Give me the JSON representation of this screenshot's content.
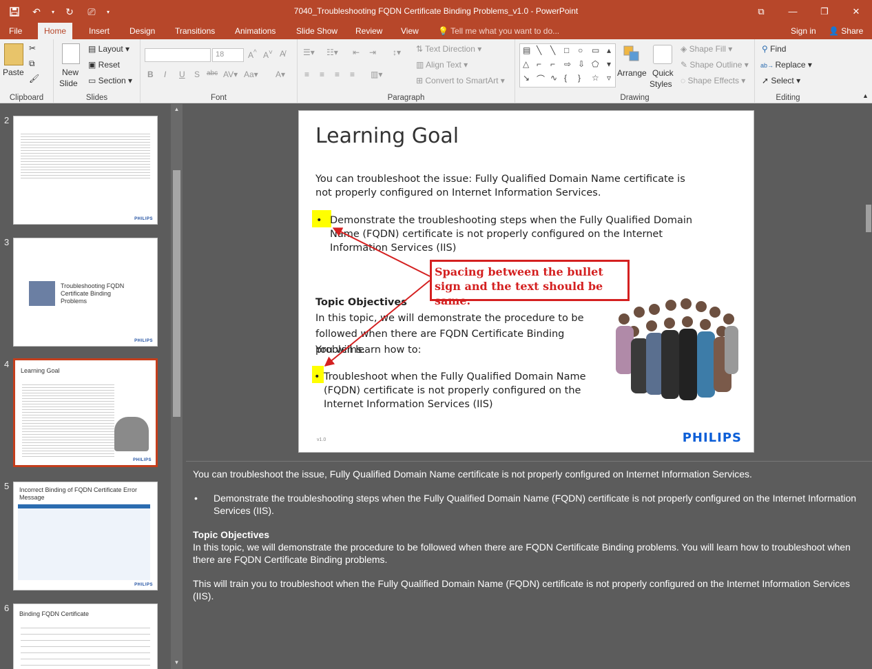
{
  "window": {
    "title": "7040_Troubleshooting FQDN Certificate Binding Problems_v1.0 - PowerPoint"
  },
  "tabs": [
    "File",
    "Home",
    "Insert",
    "Design",
    "Transitions",
    "Animations",
    "Slide Show",
    "Review",
    "View"
  ],
  "active_tab": "Home",
  "tell_me": "Tell me what you want to do...",
  "sign_in": "Sign in",
  "share": "Share",
  "ribbon": {
    "clipboard": {
      "label": "Clipboard",
      "paste": "Paste"
    },
    "slides": {
      "label": "Slides",
      "new_slide_1": "New",
      "new_slide_2": "Slide",
      "layout": "Layout",
      "reset": "Reset",
      "section": "Section"
    },
    "font": {
      "label": "Font",
      "size": "18"
    },
    "paragraph": {
      "label": "Paragraph",
      "text_direction": "Text Direction",
      "align_text": "Align Text",
      "convert_smartart": "Convert to SmartArt"
    },
    "drawing": {
      "label": "Drawing",
      "arrange": "Arrange",
      "quick_styles_1": "Quick",
      "quick_styles_2": "Styles",
      "shape_fill": "Shape Fill",
      "shape_outline": "Shape Outline",
      "shape_effects": "Shape Effects"
    },
    "editing": {
      "label": "Editing",
      "find": "Find",
      "replace": "Replace",
      "select": "Select"
    }
  },
  "thumbnails": [
    {
      "num": "2",
      "title": "",
      "logo": "PHILIPS"
    },
    {
      "num": "3",
      "title": "Troubleshooting FQDN Certificate Binding Problems",
      "logo": "PHILIPS"
    },
    {
      "num": "4",
      "title": "Learning Goal",
      "logo": "PHILIPS"
    },
    {
      "num": "5",
      "title": "Incorrect Binding of FQDN Certificate Error Message",
      "logo": "PHILIPS"
    },
    {
      "num": "6",
      "title": "Binding FQDN Certificate",
      "logo": ""
    }
  ],
  "slide": {
    "title": "Learning Goal",
    "intro": "You can troubleshoot the issue: Fully Qualified Domain Name certificate is not properly configured on Internet Information Services.",
    "bullet1": "Demonstrate the troubleshooting steps when the Fully Qualified Domain Name (FQDN) certificate is not properly configured on the Internet Information Services (IIS)",
    "topic_heading": "Topic Objectives",
    "topic_text": "In this topic, we will demonstrate the procedure to be followed when there are FQDN Certificate Binding problems.",
    "learn_how": "You will learn how to:",
    "bullet2": "Troubleshoot when the Fully Qualified Domain Name (FQDN) certificate is not properly configured on the Internet Information Services (IIS)",
    "callout": "Spacing between the bullet sign and the text should be same.",
    "version": "v1.0",
    "logo": "PHILIPS"
  },
  "notes": {
    "p1": "You can troubleshoot the issue, Fully Qualified Domain Name certificate is not properly configured on Internet Information Services.",
    "p2": "Demonstrate the troubleshooting steps when the Fully Qualified Domain Name (FQDN) certificate is not properly configured on the Internet Information Services (IIS).",
    "p3_heading": "Topic Objectives",
    "p3": "In this topic, we will demonstrate the procedure to be followed when there are FQDN Certificate Binding problems. You will learn how to troubleshoot when there are FQDN Certificate Binding problems.",
    "p4": "This will train you to troubleshoot when the Fully Qualified Domain Name (FQDN) certificate is not properly configured on the Internet Information Services (IIS)."
  },
  "colors": {
    "accent": "#b7472a",
    "callout": "#d42020",
    "highlight": "#ffff00"
  }
}
